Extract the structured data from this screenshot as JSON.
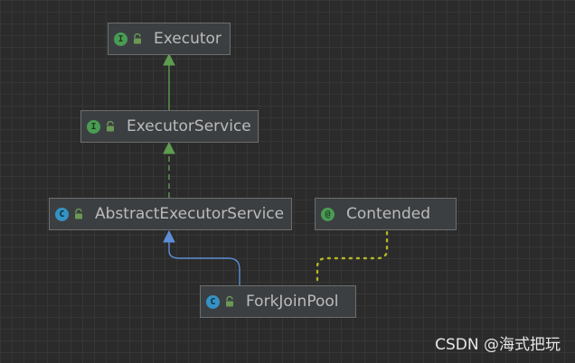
{
  "nodes": [
    {
      "id": "executor",
      "label": "Executor",
      "kind": "interface",
      "badge": "I",
      "badge_color": "#499c54",
      "badge_text_color": "#1e3a1f"
    },
    {
      "id": "executor_service",
      "label": "ExecutorService",
      "kind": "interface",
      "badge": "I",
      "badge_color": "#499c54",
      "badge_text_color": "#1e3a1f"
    },
    {
      "id": "abstract_executor_service",
      "label": "AbstractExecutorService",
      "kind": "abstract-class",
      "badge": "C",
      "badge_color": "#3592c4",
      "badge_text_color": "#0f2a3a"
    },
    {
      "id": "contended",
      "label": "Contended",
      "kind": "annotation",
      "badge": "@",
      "badge_color": "#499c54",
      "badge_text_color": "#1e3a1f"
    },
    {
      "id": "fork_join_pool",
      "label": "ForkJoinPool",
      "kind": "class",
      "badge": "C",
      "badge_color": "#3592c4",
      "badge_text_color": "#0f2a3a"
    }
  ],
  "edges": [
    {
      "from": "executor_service",
      "to": "executor",
      "type": "extends",
      "style": "solid",
      "color": "#5e9c4f"
    },
    {
      "from": "abstract_executor_service",
      "to": "executor_service",
      "type": "implements",
      "style": "dashed",
      "color": "#5e9c4f"
    },
    {
      "from": "fork_join_pool",
      "to": "abstract_executor_service",
      "type": "extends",
      "style": "solid",
      "color": "#5c8fd6"
    },
    {
      "from": "fork_join_pool",
      "to": "contended",
      "type": "annotated-by",
      "style": "dotted",
      "color": "#b5b526"
    }
  ],
  "icons": {
    "visibility": "lock-icon",
    "lock_color": "#6a9955"
  },
  "watermark": "CSDN @海式把玩"
}
